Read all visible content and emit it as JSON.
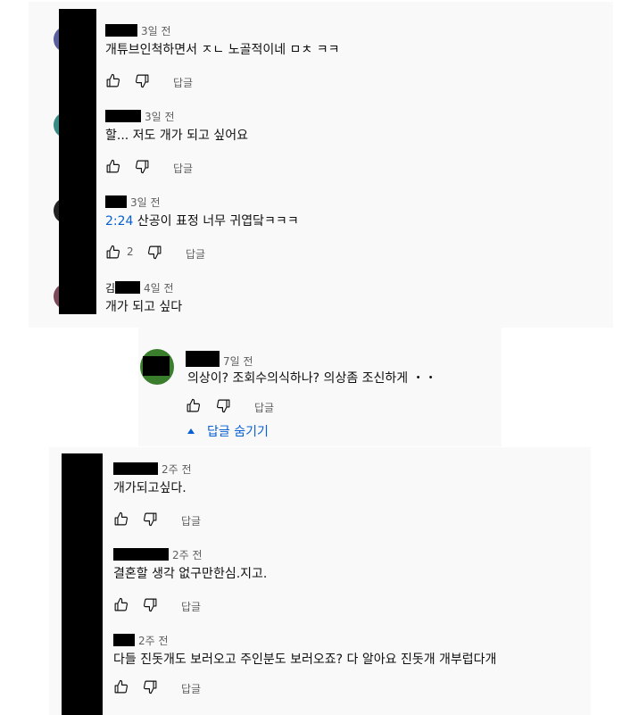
{
  "thread1": [
    {
      "author": "",
      "time": "3일 전",
      "text": "개튜브인척하면서 ㅈㄴ 노골적이네 ㅁㅊ ㅋㅋ",
      "likes": "",
      "reply": "답글"
    },
    {
      "author": "",
      "time": "3일 전",
      "text": "할... 저도 개가 되고 싶어요",
      "likes": "",
      "reply": "답글"
    },
    {
      "author": "",
      "time": "3일 전",
      "timestamp": "2:24",
      "text": " 산공이 표정 너무 귀엽닼ㅋㅋㅋ",
      "likes": "2",
      "reply": "답글"
    },
    {
      "author": "김",
      "time": "4일 전",
      "text": "개가 되고 싶다",
      "likes": "",
      "reply": "답글"
    }
  ],
  "reply": {
    "author": "",
    "time": "7일 전",
    "text": "의상이? 조회수의식하나? 의상좀 조신하게 ・・",
    "reply": "답글",
    "hide_replies": "답글 숨기기"
  },
  "thread2": [
    {
      "author": "",
      "time": "2주 전",
      "text": "개가되고싶다.",
      "reply": "답글"
    },
    {
      "author": "",
      "time": "2주 전",
      "text": "결혼할 생각 없구만한심.지고.",
      "reply": "답글"
    },
    {
      "author": "",
      "time": "2주 전",
      "text": "다들 진돗개도 보러오고 주인분도 보러오죠? 다 알아요 진돗개 개부럽다개",
      "reply": "답글"
    }
  ],
  "colors": {
    "panel": "#f9f9f9",
    "link": "#065fd4",
    "meta": "#606060",
    "reply_avatar": "#3a7d2c"
  },
  "icons": [
    "thumb-up-icon",
    "thumb-down-icon",
    "caret-up-icon"
  ]
}
